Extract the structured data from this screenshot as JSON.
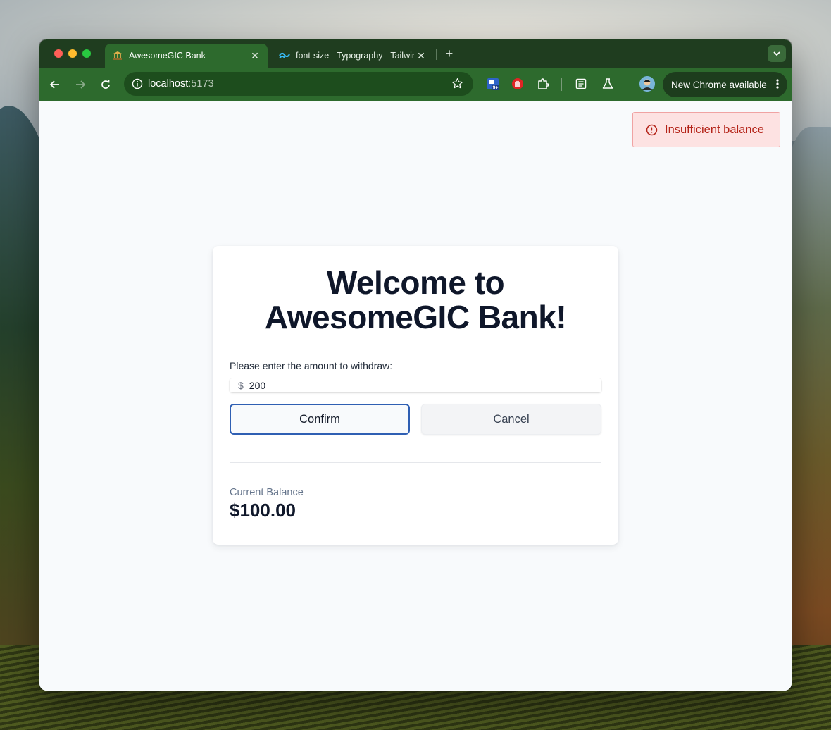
{
  "browser": {
    "tabs": [
      {
        "title": "AwesomeGIC Bank",
        "icon": "bank-icon",
        "active": true
      },
      {
        "title": "font-size - Typography - Tailwind CSS",
        "icon": "tailwind-icon",
        "active": false
      }
    ],
    "url_host": "localhost",
    "url_port": ":5173",
    "extension_badge": "9+",
    "update_label": "New Chrome available"
  },
  "toast": {
    "message": "Insufficient balance",
    "icon": "alert-circle-icon",
    "color": "#b42318"
  },
  "card": {
    "title_line1": "Welcome to",
    "title_line2": "AwesomeGIC Bank!",
    "prompt": "Please enter the amount to withdraw:",
    "currency_prefix": "$",
    "amount_value": "200",
    "confirm_label": "Confirm",
    "cancel_label": "Cancel",
    "balance_label": "Current Balance",
    "balance_value": "$100.00"
  },
  "colors": {
    "browser_frame": "#2d6a2d",
    "accent": "#2f5fb3",
    "toast_bg": "#fde2e2"
  }
}
